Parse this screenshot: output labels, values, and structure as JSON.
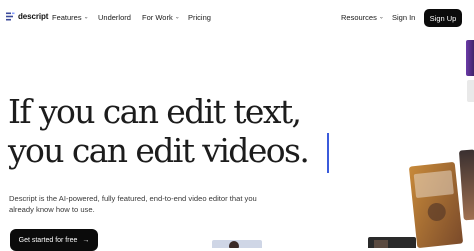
{
  "brand": {
    "name": "descript"
  },
  "nav": {
    "features": "Features",
    "underlord": "Underlord",
    "for_work": "For Work",
    "pricing": "Pricing",
    "resources": "Resources",
    "sign_in": "Sign In",
    "sign_up": "Sign Up"
  },
  "hero": {
    "headline_line1": "If you can edit text,",
    "headline_line2": "you can edit videos.",
    "subheading": "Descript is the AI-powered, fully featured, end-to-end video editor that you already know how to use.",
    "cta_label": "Get started for free",
    "cta_arrow": "→"
  },
  "icons": {
    "logo": "descript-logo-icon",
    "dropdown": "chevron-down-icon",
    "arrow": "arrow-right-icon"
  },
  "colors": {
    "background": "#ffffff",
    "text": "#1c1c1c",
    "button_bg": "#0b0b0b",
    "button_text": "#ffffff",
    "cursor": "#3b5bdb"
  }
}
